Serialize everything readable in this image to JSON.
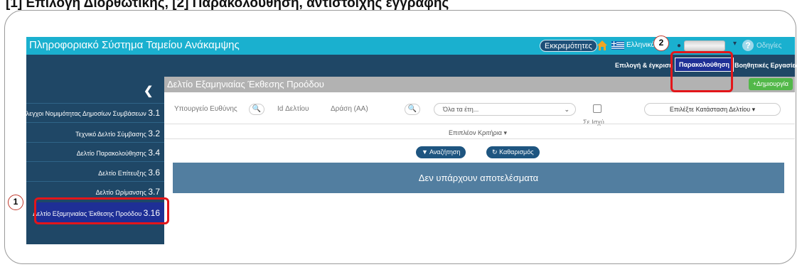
{
  "doc_heading": "[1] Επιλογή Διορθωτικής, [2] Παρακολούθηση, αντίστοιχης εγγραφής",
  "app": {
    "title": "Πληροφοριακό Σύστημα Ταμείου Ανάκαμψης",
    "pending_label": "Εκκρεμότητες",
    "language_label": "Ελληνικά",
    "help_label": "Οδηγίες",
    "icons": {
      "home": "home-icon",
      "flag": "greek-flag-icon",
      "user": "user-icon",
      "caret": "caret-down-icon",
      "help": "help-icon"
    },
    "colors": {
      "topbar": "#1ab0cf",
      "navbar": "#1f4766",
      "active": "#1e2f96",
      "create": "#52b849",
      "highlight": "#e3161a"
    }
  },
  "nav": {
    "items": [
      {
        "label": "Επιλογή & έγκριση",
        "active": false
      },
      {
        "label": "Παρακολούθηση",
        "active": true
      },
      {
        "label": "Βοηθητικές Εργασίες",
        "active": false
      }
    ]
  },
  "sidebar": {
    "collapse_icon": "chevron-left-icon",
    "items": [
      {
        "label": "Έλεγχοι Νομιμότητας Δημοσίων Συμβάσεων",
        "num": "3.1"
      },
      {
        "label": "Τεχνικό Δελτίο Σύμβασης",
        "num": "3.2"
      },
      {
        "label": "Δελτίο Παρακολούθησης",
        "num": "3.4"
      },
      {
        "label": "Δελτίο Επίτευξης",
        "num": "3.6"
      },
      {
        "label": "Δελτίο Ωρίμανσης",
        "num": "3.7"
      },
      {
        "label": "Δελτίο Εξαμηνιαίας Έκθεσης Προόδου",
        "num": "3.16",
        "active": true
      }
    ]
  },
  "content": {
    "title": "Δελτίο Εξαμηνιαίας Έκθεσης Προόδου",
    "create_label": "+Δημιουργία",
    "filters": {
      "ministry_label": "Υπουργείο Ευθύνης",
      "id_label": "Id Δελτίου",
      "action_label": "Δράση (ΑΑ)",
      "years_placeholder": "Όλα τα έτη...",
      "in_force_label": "Σε Ισχύ",
      "status_placeholder": "Επιλέξτε Κατάσταση Δελτίου ▾",
      "more_criteria": "Επιπλέον Κριτήρια ▾"
    },
    "search_button": "Αναζήτηση",
    "clear_button": "Καθαρισμός",
    "no_results": "Δεν υπάρχουν αποτελέσματα"
  },
  "callouts": {
    "first": "1",
    "second": "2"
  }
}
